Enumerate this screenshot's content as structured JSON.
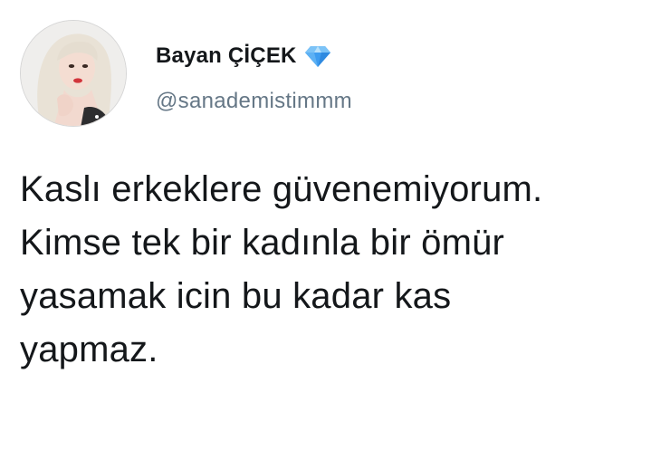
{
  "profile": {
    "display_name": "Bayan ÇİÇEK",
    "handle": "@sanademistimmm",
    "avatar_icon": "profile-photo",
    "badge_icon": "diamond-icon",
    "badge_color": "#3d9cf0"
  },
  "tweet": {
    "lines": [
      "Kaslı erkeklere güvenemiyorum.",
      "Kimse tek bir kadınla bir ömür",
      "yasamak icin bu kadar kas",
      "yapmaz."
    ]
  },
  "colors": {
    "text": "#14171a",
    "handle": "#657786",
    "background": "#ffffff"
  }
}
